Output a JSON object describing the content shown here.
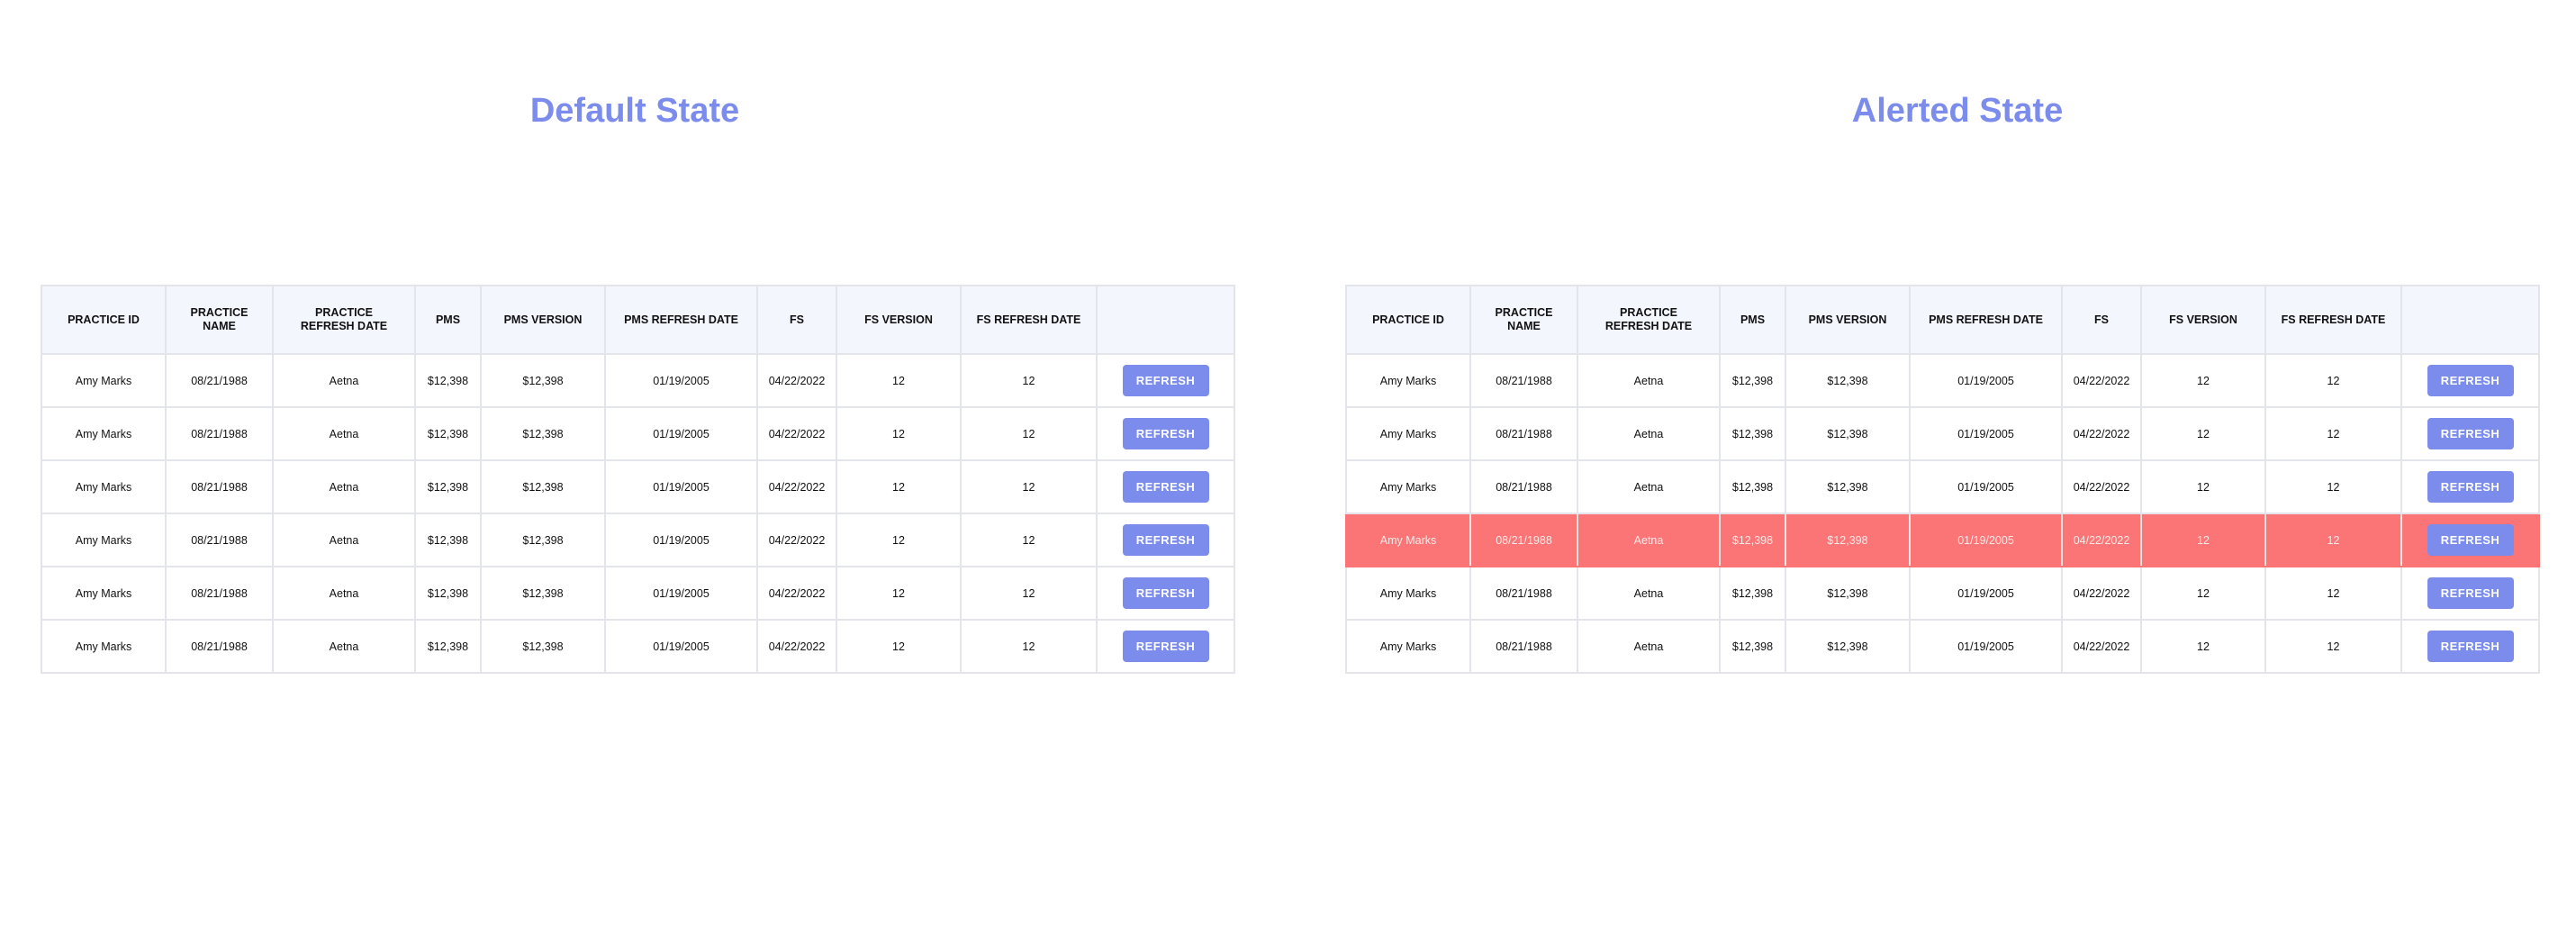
{
  "panels": {
    "default": {
      "title": "Default State"
    },
    "alerted": {
      "title": "Alerted State"
    }
  },
  "columns": [
    "PRACTICE ID",
    "PRACTICE\nNAME",
    "PRACTICE\nREFRESH DATE",
    "PMS",
    "PMS VERSION",
    "PMS  REFRESH DATE",
    "FS",
    "FS VERSION",
    "FS REFRESH DATE",
    ""
  ],
  "rows": [
    {
      "practice_id": "Amy Marks",
      "practice_name": "08/21/1988",
      "practice_refresh_date": "Aetna",
      "pms": "$12,398",
      "pms_version": "$12,398",
      "pms_refresh_date": "01/19/2005",
      "fs": "04/22/2022",
      "fs_version": "12",
      "fs_refresh_date": "12",
      "action": "REFRESH"
    },
    {
      "practice_id": "Amy Marks",
      "practice_name": "08/21/1988",
      "practice_refresh_date": "Aetna",
      "pms": "$12,398",
      "pms_version": "$12,398",
      "pms_refresh_date": "01/19/2005",
      "fs": "04/22/2022",
      "fs_version": "12",
      "fs_refresh_date": "12",
      "action": "REFRESH"
    },
    {
      "practice_id": "Amy Marks",
      "practice_name": "08/21/1988",
      "practice_refresh_date": "Aetna",
      "pms": "$12,398",
      "pms_version": "$12,398",
      "pms_refresh_date": "01/19/2005",
      "fs": "04/22/2022",
      "fs_version": "12",
      "fs_refresh_date": "12",
      "action": "REFRESH"
    },
    {
      "practice_id": "Amy Marks",
      "practice_name": "08/21/1988",
      "practice_refresh_date": "Aetna",
      "pms": "$12,398",
      "pms_version": "$12,398",
      "pms_refresh_date": "01/19/2005",
      "fs": "04/22/2022",
      "fs_version": "12",
      "fs_refresh_date": "12",
      "action": "REFRESH"
    },
    {
      "practice_id": "Amy Marks",
      "practice_name": "08/21/1988",
      "practice_refresh_date": "Aetna",
      "pms": "$12,398",
      "pms_version": "$12,398",
      "pms_refresh_date": "01/19/2005",
      "fs": "04/22/2022",
      "fs_version": "12",
      "fs_refresh_date": "12",
      "action": "REFRESH"
    },
    {
      "practice_id": "Amy Marks",
      "practice_name": "08/21/1988",
      "practice_refresh_date": "Aetna",
      "pms": "$12,398",
      "pms_version": "$12,398",
      "pms_refresh_date": "01/19/2005",
      "fs": "04/22/2022",
      "fs_version": "12",
      "fs_refresh_date": "12",
      "action": "REFRESH"
    }
  ],
  "alerted_row_index": 3,
  "colors": {
    "accent": "#7b8cec",
    "header_bg": "#f3f6fd",
    "alert_row": "#fc7576",
    "border": "#e3e5ea"
  }
}
